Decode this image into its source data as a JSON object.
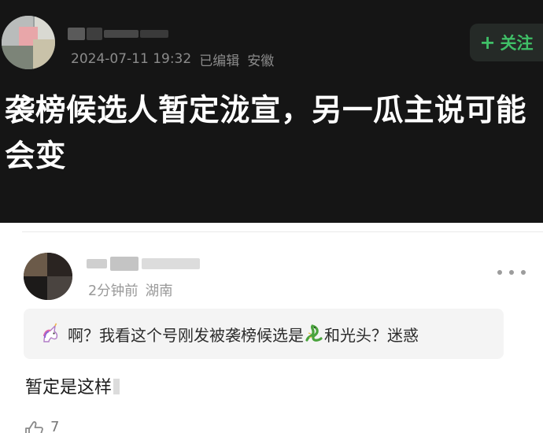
{
  "post": {
    "timestamp": "2024-07-11 19:32",
    "edited_label": "已编辑",
    "location": "安徽",
    "follow_label": "关注",
    "follow_plus": "+",
    "title": "袭榜候选人暂定泷宣，另一瓜主说可能会变"
  },
  "comment": {
    "time": "2分钟前",
    "location": "湖南",
    "quote_part1": "啊？我看这个号刚发被袭榜候选是",
    "quote_part2": "和光头？迷惑",
    "text": "暂定是这样",
    "like_count": "7"
  },
  "colors": {
    "post_background": "#151515",
    "follow_accent": "#3fbf67",
    "quote_background": "#f4f4f4"
  },
  "icons": [
    "unicorn-icon",
    "dragon-icon",
    "more-icon",
    "thumbs-up-icon"
  ]
}
